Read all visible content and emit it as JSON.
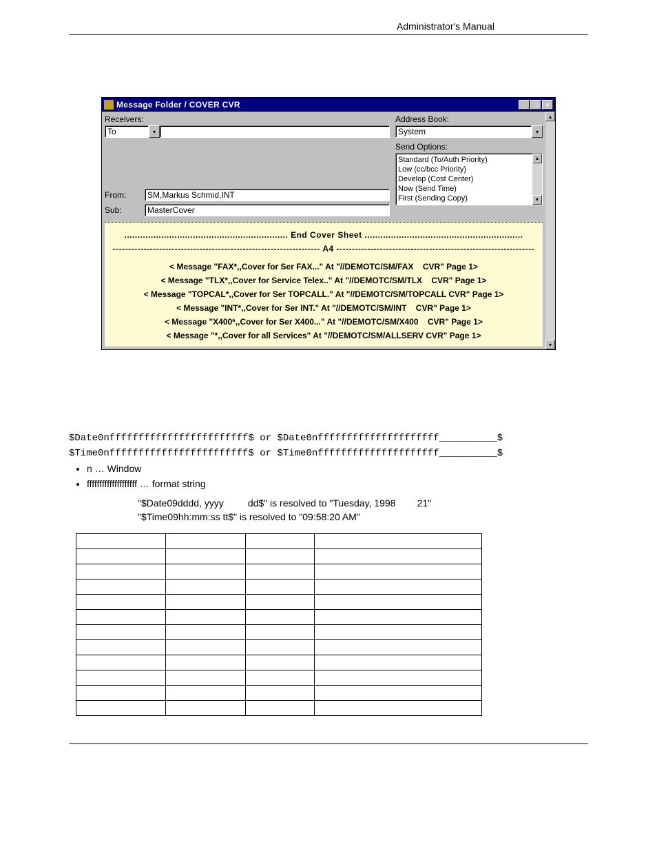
{
  "header": {
    "title": "Administrator's Manual"
  },
  "window": {
    "title": "Message Folder / COVER   CVR",
    "labels": {
      "receivers": "Receivers:",
      "address_book": "Address Book:",
      "send_options": "Send Options:",
      "from": "From:",
      "sub": "Sub:"
    },
    "to_selector": "To",
    "address_book_value": "System",
    "send_options_items": [
      "Standard   (To/Auth Priority)",
      "Low   (cc/bcc Priority)",
      "Develop   (Cost Center)",
      "Now   (Send Time)",
      "First   (Sending Copy)"
    ],
    "from_value": "SM,Markus Schmid,INT",
    "sub_value": "MasterCover",
    "cover_heading": "End Cover Sheet",
    "a4_heading": "A4",
    "messages": [
      "< Message \"FAX*,,Cover for Ser FAX...\" At \"//DEMOTC/SM/FAX    CVR\" Page 1>",
      "< Message \"TLX*,,Cover for Service Telex..\" At \"//DEMOTC/SM/TLX    CVR\" Page 1>",
      "< Message \"TOPCAL*,,Cover for Ser TOPCALL.\" At \"//DEMOTC/SM/TOPCALL CVR\" Page 1>",
      "< Message \"INT*,,Cover for Ser INT.\" At \"//DEMOTC/SM/INT    CVR\" Page 1>",
      "< Message \"X400*,,Cover for Ser X400...\" At \"//DEMOTC/SM/X400    CVR\" Page 1>",
      "< Message \"*,,Cover for all Services\" At \"//DEMOTC/SM/ALLSERV CVR\" Page 1>"
    ]
  },
  "code": {
    "line1": "$Date0nffffffffffffffffffffffff$ or $Date0nfffffffffffffffffffff__________$",
    "line2": "$Time0nffffffffffffffffffffffff$ or $Time0nfffffffffffffffffffff__________$"
  },
  "bullets": {
    "b1": "n … Window",
    "b2": "ffffffffffffffffffff … format string"
  },
  "examples": {
    "e1": "\"$Date09dddd, yyyy         dd$\" is resolved to \"Tuesday, 1998        21\"",
    "e2": "\"$Time09hh:mm:ss tt$\" is resolved to \"09:58:20 AM\""
  },
  "table": {
    "rows": 12,
    "cols": 4
  }
}
